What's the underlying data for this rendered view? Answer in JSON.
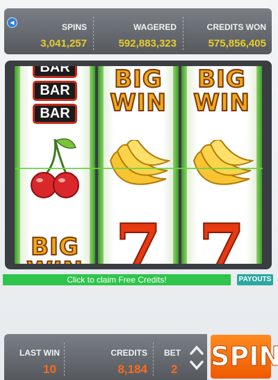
{
  "stats": {
    "spins": {
      "label": "SPINS",
      "value": "3,041,257"
    },
    "wagered": {
      "label": "WAGERED",
      "value": "592,883,323"
    },
    "credits_won": {
      "label": "CREDITS WON",
      "value": "575,856,405"
    }
  },
  "speaker_icon": "speaker-icon",
  "reels": [
    {
      "top": "bar-stack",
      "middle": "cherries",
      "bottom": "big-win"
    },
    {
      "top": "big-win",
      "middle": "banana",
      "bottom": "seven"
    },
    {
      "top": "big-win",
      "middle": "banana",
      "bottom": "seven"
    }
  ],
  "symbols": {
    "bar_text": "BAR",
    "big_text": "BIG",
    "win_text": "WIN",
    "seven_text": "7"
  },
  "claim_label": "Click to claim Free Credits!",
  "payouts_label": "PAYOUTS",
  "bottom": {
    "last_win": {
      "label": "LAST WIN",
      "value": "10"
    },
    "credits": {
      "label": "CREDITS",
      "value": "8,184"
    },
    "bet": {
      "label": "BET",
      "value": "2"
    }
  },
  "spin_label": "SPIN",
  "colors": {
    "accent_orange": "#ee5a00",
    "claim_green": "#2fc44b",
    "stat_yellow": "#e8cc2a",
    "payouts_teal": "#2aa8a0"
  }
}
